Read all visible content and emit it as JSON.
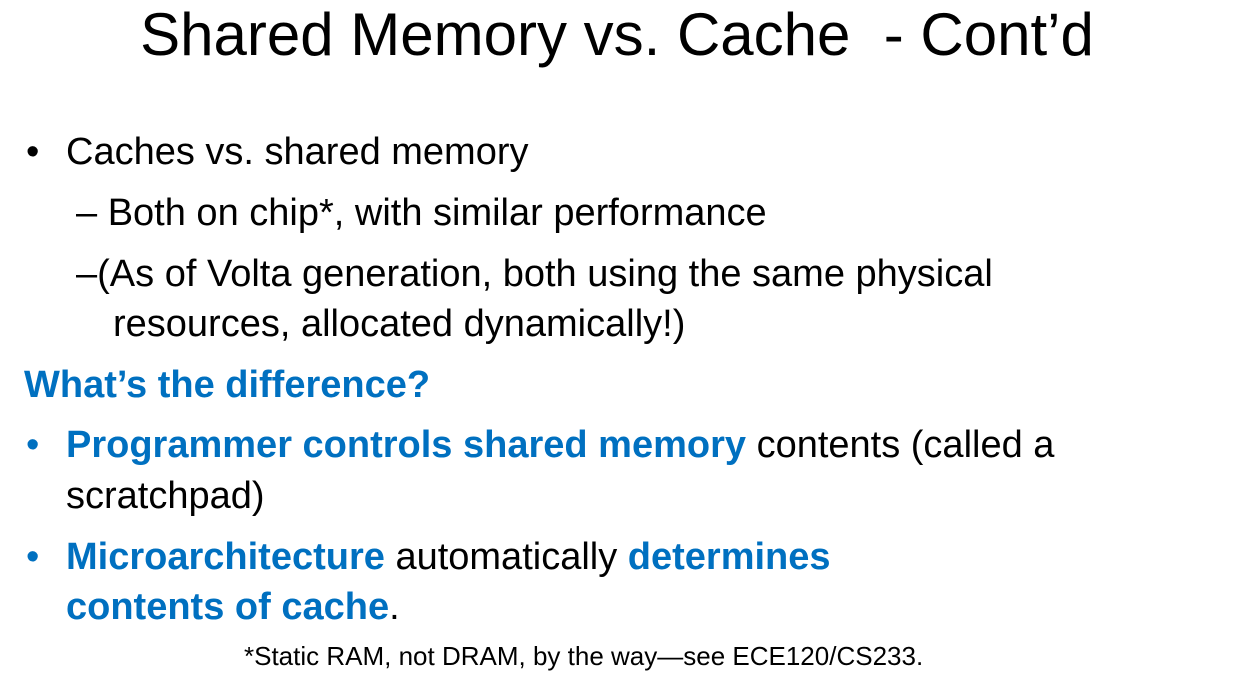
{
  "title": "Shared Memory vs. Cache  - Cont’d",
  "bullet_char": "•",
  "bullets": [
    {
      "text": "Caches vs. shared memory",
      "sub": [
        {
          "dash": "–",
          "text": "Both on chip*, with similar performance"
        },
        {
          "dash": "–",
          "line1": "(As of Volta generation, both using the same physical",
          "line2": "resources, allocated dynamically!)"
        }
      ]
    }
  ],
  "heading": "What’s the difference?",
  "points": [
    {
      "highlight": "Programmer controls shared memory",
      "rest": " contents (called a",
      "line2": "scratchpad)"
    },
    {
      "highlight": "Microarchitecture",
      "mid": " automatically ",
      "highlight2": "determines",
      "line2_highlight": "contents of cache",
      "line2_rest": "."
    }
  ],
  "footnote": "*Static RAM, not DRAM, by the way—see ECE120/CS233.",
  "colors": {
    "accent": "#0070c0",
    "text": "#000000",
    "background": "#ffffff"
  }
}
